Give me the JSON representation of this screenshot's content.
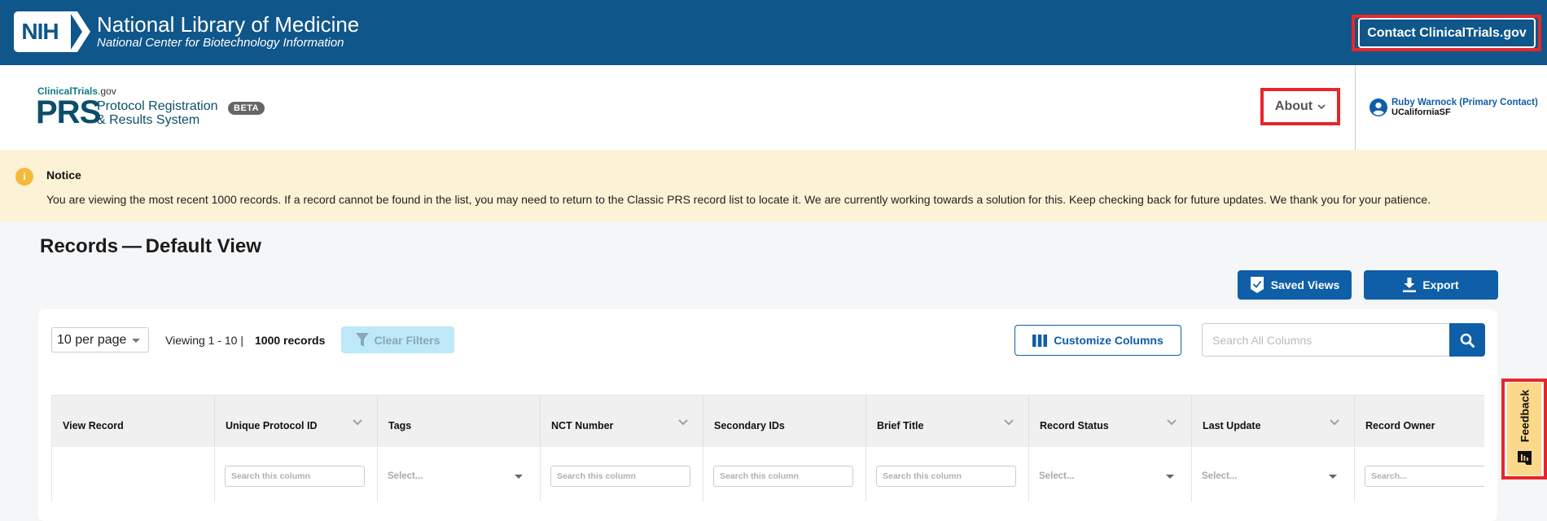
{
  "nih_header": {
    "logo_badge": "NIH",
    "title": "National Library of Medicine",
    "subtitle": "National Center for Biotechnology Information",
    "contact_button": "Contact ClinicalTrials.gov"
  },
  "prs_header": {
    "site_label_bold": "ClinicalTrials",
    "site_label_suffix": ".gov",
    "logo_big": "PRS",
    "logo_line1": "Protocol Registration",
    "logo_line2": "& Results System",
    "beta_badge": "BETA",
    "about_menu": "About",
    "user": {
      "name": "Ruby Warnock (Primary Contact)",
      "org": "UCaliforniaSF"
    }
  },
  "notice": {
    "title": "Notice",
    "body": "You are viewing the most recent 1000 records. If a record cannot be found in the list, you may need to return to the Classic PRS record list to locate it. We are currently working towards a solution for this. Keep checking back for future updates. We thank you for your patience."
  },
  "records": {
    "title": "Records — Default View",
    "saved_views_button": "Saved Views",
    "export_button": "Export",
    "per_page": "10 per page",
    "viewing": "Viewing 1 - 10 |",
    "total": "1000 records",
    "clear_filters_button": "Clear Filters",
    "customize_columns_button": "Customize Columns",
    "search_placeholder": "Search All Columns",
    "columns": [
      {
        "label": "View Record",
        "sortable": false,
        "filter": "none",
        "filter_text": ""
      },
      {
        "label": "Unique Protocol ID",
        "sortable": true,
        "filter": "search",
        "filter_text": "Search this column"
      },
      {
        "label": "Tags",
        "sortable": false,
        "filter": "select",
        "filter_text": "Select..."
      },
      {
        "label": "NCT Number",
        "sortable": true,
        "filter": "search",
        "filter_text": "Search this column"
      },
      {
        "label": "Secondary IDs",
        "sortable": false,
        "filter": "search",
        "filter_text": "Search this column"
      },
      {
        "label": "Brief Title",
        "sortable": true,
        "filter": "search",
        "filter_text": "Search this column"
      },
      {
        "label": "Record Status",
        "sortable": true,
        "filter": "select",
        "filter_text": "Select..."
      },
      {
        "label": "Last Update",
        "sortable": true,
        "filter": "select",
        "filter_text": "Select..."
      },
      {
        "label": "Record Owner",
        "sortable": false,
        "filter": "search",
        "filter_text": "Search..."
      }
    ]
  },
  "feedback": {
    "label": "Feedback"
  },
  "colors": {
    "nih_blue": "#0f568a",
    "primary_blue": "#0f5ea8",
    "prs_teal": "#0b4e6a",
    "notice_bg": "#fcf2d5",
    "notice_icon": "#f5b93d",
    "highlight_red": "#e8262a",
    "feedback_bg": "#fcd88a"
  }
}
